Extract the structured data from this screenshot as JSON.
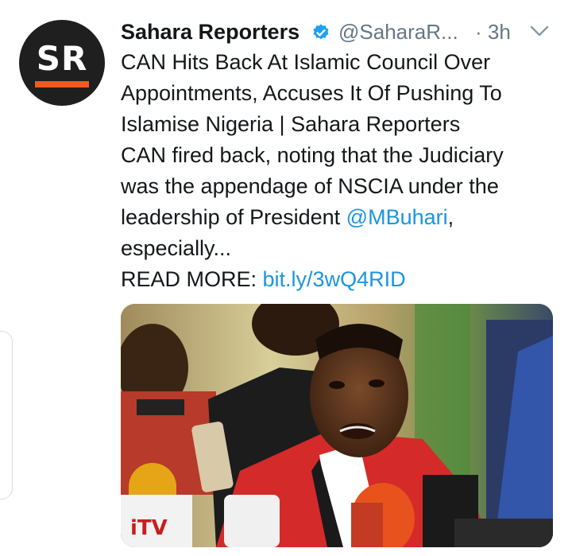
{
  "tweet": {
    "author_name": "Sahara Reporters",
    "handle": "@SaharaR...",
    "time": "· 3h",
    "avatar_initials": "SR",
    "lines": {
      "l1": "CAN Hits Back At Islamic Council Over",
      "l2": "Appointments, Accuses It Of Pushing To",
      "l3": "Islamise Nigeria | Sahara Reporters",
      "l4": "CAN fired back, noting that the Judiciary",
      "l5": "was the appendage of NSCIA under the",
      "l6_prefix": "leadership of President ",
      "mention": "@MBuhari",
      "l6_suffix": ",",
      "l7": "especially...",
      "read_more_label": "READ MORE: ",
      "link": "bit.ly/3wQ4RID"
    },
    "icons": {
      "verified": "verified-badge-icon",
      "caret": "chevron-down-icon"
    },
    "media_logo_text": "iTV",
    "colors": {
      "text": "#14171a",
      "secondary": "#657786",
      "link": "#1b95e0",
      "verified": "#1da1f2",
      "avatar_bg": "#1f1f1f",
      "avatar_accent": "#f05a22"
    }
  }
}
